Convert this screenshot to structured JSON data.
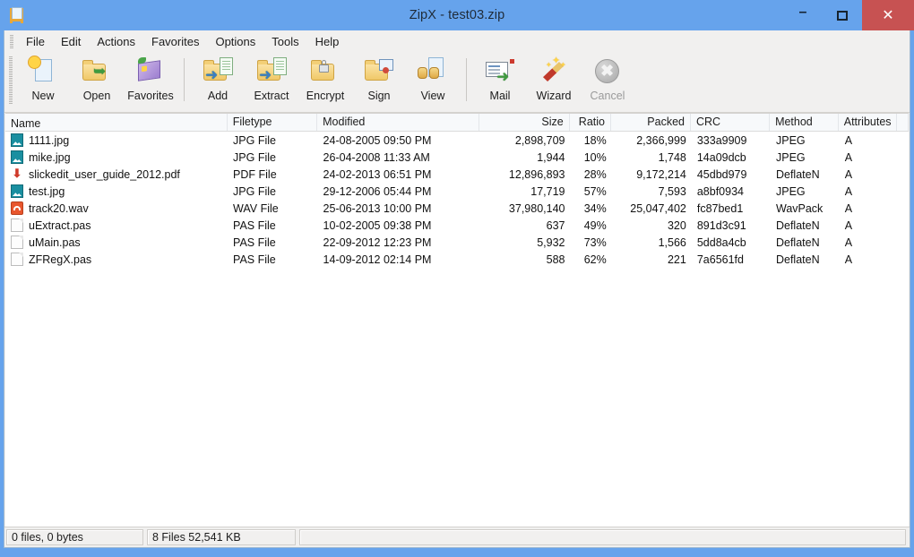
{
  "window": {
    "title": "ZipX - test03.zip",
    "app_icon": "zip-document-icon",
    "controls": {
      "minimize": "–",
      "maximize": "",
      "close": "✕"
    },
    "colors": {
      "titlebar": "#66a3ec",
      "close_button": "#c75252",
      "chrome": "#f1f0ef",
      "list_background": "#ffffff"
    }
  },
  "menubar": {
    "items": [
      {
        "label": "File"
      },
      {
        "label": "Edit"
      },
      {
        "label": "Actions"
      },
      {
        "label": "Favorites"
      },
      {
        "label": "Options"
      },
      {
        "label": "Tools"
      },
      {
        "label": "Help"
      }
    ]
  },
  "toolbar": {
    "buttons": [
      {
        "label": "New",
        "icon": "new-document-icon",
        "disabled": false
      },
      {
        "label": "Open",
        "icon": "open-folder-icon",
        "disabled": false
      },
      {
        "label": "Favorites",
        "icon": "favorites-book-icon",
        "disabled": false
      },
      {
        "label": "Add",
        "icon": "add-to-archive-icon",
        "disabled": false
      },
      {
        "label": "Extract",
        "icon": "extract-icon",
        "disabled": false
      },
      {
        "label": "Encrypt",
        "icon": "encrypt-lock-icon",
        "disabled": false
      },
      {
        "label": "Sign",
        "icon": "sign-certificate-icon",
        "disabled": false
      },
      {
        "label": "View",
        "icon": "view-binoculars-icon",
        "disabled": false
      },
      {
        "label": "Mail",
        "icon": "mail-envelope-icon",
        "disabled": false
      },
      {
        "label": "Wizard",
        "icon": "wizard-wand-icon",
        "disabled": false
      },
      {
        "label": "Cancel",
        "icon": "cancel-icon",
        "disabled": true
      }
    ]
  },
  "filelist": {
    "columns": [
      {
        "key": "name",
        "label": "Name"
      },
      {
        "key": "filetype",
        "label": "Filetype"
      },
      {
        "key": "modified",
        "label": "Modified"
      },
      {
        "key": "size",
        "label": "Size"
      },
      {
        "key": "ratio",
        "label": "Ratio"
      },
      {
        "key": "packed",
        "label": "Packed"
      },
      {
        "key": "crc",
        "label": "CRC"
      },
      {
        "key": "method",
        "label": "Method"
      },
      {
        "key": "attributes",
        "label": "Attributes"
      }
    ],
    "rows": [
      {
        "icon": "image-file-icon",
        "name": "1111.jpg",
        "filetype": "JPG File",
        "modified": "24-08-2005  09:50 PM",
        "size": "2,898,709",
        "ratio": "18%",
        "packed": "2,366,999",
        "crc": "333a9909",
        "method": "JPEG",
        "attributes": "A"
      },
      {
        "icon": "image-file-icon",
        "name": "mike.jpg",
        "filetype": "JPG File",
        "modified": "26-04-2008  11:33 AM",
        "size": "1,944",
        "ratio": "10%",
        "packed": "1,748",
        "crc": "14a09dcb",
        "method": "JPEG",
        "attributes": "A"
      },
      {
        "icon": "pdf-file-icon",
        "name": "slickedit_user_guide_2012.pdf",
        "filetype": "PDF File",
        "modified": "24-02-2013  06:51 PM",
        "size": "12,896,893",
        "ratio": "28%",
        "packed": "9,172,214",
        "crc": "45dbd979",
        "method": "DeflateN",
        "attributes": "A"
      },
      {
        "icon": "image-file-icon",
        "name": "test.jpg",
        "filetype": "JPG File",
        "modified": "29-12-2006  05:44 PM",
        "size": "17,719",
        "ratio": "57%",
        "packed": "7,593",
        "crc": "a8bf0934",
        "method": "JPEG",
        "attributes": "A"
      },
      {
        "icon": "audio-file-icon",
        "name": "track20.wav",
        "filetype": "WAV File",
        "modified": "25-06-2013  10:00 PM",
        "size": "37,980,140",
        "ratio": "34%",
        "packed": "25,047,402",
        "crc": "fc87bed1",
        "method": "WavPack",
        "attributes": "A"
      },
      {
        "icon": "generic-file-icon",
        "name": "uExtract.pas",
        "filetype": "PAS File",
        "modified": "10-02-2005  09:38 PM",
        "size": "637",
        "ratio": "49%",
        "packed": "320",
        "crc": "891d3c91",
        "method": "DeflateN",
        "attributes": "A"
      },
      {
        "icon": "generic-file-icon",
        "name": "uMain.pas",
        "filetype": "PAS File",
        "modified": "22-09-2012  12:23 PM",
        "size": "5,932",
        "ratio": "73%",
        "packed": "1,566",
        "crc": "5dd8a4cb",
        "method": "DeflateN",
        "attributes": "A"
      },
      {
        "icon": "generic-file-icon",
        "name": "ZFRegX.pas",
        "filetype": "PAS File",
        "modified": "14-09-2012  02:14 PM",
        "size": "588",
        "ratio": "62%",
        "packed": "221",
        "crc": "7a6561fd",
        "method": "DeflateN",
        "attributes": "A"
      }
    ]
  },
  "statusbar": {
    "selection": "0 files, 0 bytes",
    "totals": "8 Files 52,541 KB",
    "extra": ""
  }
}
